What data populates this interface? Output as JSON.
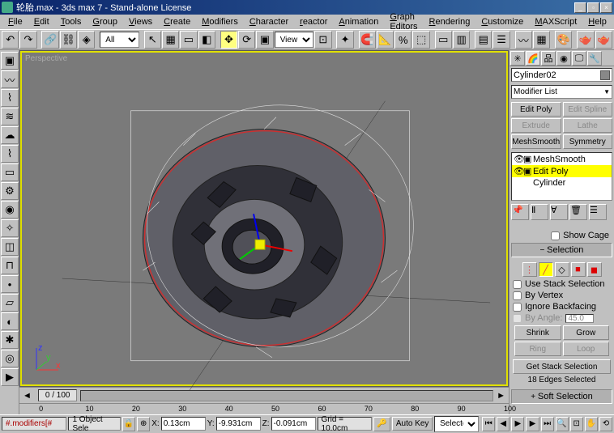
{
  "title": "轮胎.max - 3ds max 7 - Stand-alone License",
  "menus": [
    "File",
    "Edit",
    "Tools",
    "Group",
    "Views",
    "Create",
    "Modifiers",
    "Character",
    "reactor",
    "Animation",
    "Graph Editors",
    "Rendering",
    "Customize",
    "MAXScript",
    "Help"
  ],
  "toolbar": {
    "filter": "All",
    "view_dd": "View"
  },
  "viewport": {
    "label": "Perspective"
  },
  "timeline": {
    "frame": "0 / 100",
    "ticks": [
      "0",
      "10",
      "20",
      "30",
      "40",
      "50",
      "60",
      "70",
      "80",
      "90",
      "100"
    ]
  },
  "panel": {
    "objectName": "Cylinder02",
    "modifierList": "Modifier List",
    "buttons": {
      "editPoly": "Edit Poly",
      "editSpline": "Edit Spline",
      "extrude": "Extrude",
      "lathe": "Lathe",
      "meshSmooth": "MeshSmooth",
      "symmetry": "Symmetry"
    },
    "stack": [
      {
        "name": "MeshSmooth",
        "sel": false,
        "eye": true
      },
      {
        "name": "Edit Poly",
        "sel": true,
        "eye": true
      },
      {
        "name": "Cylinder",
        "sel": false,
        "eye": false
      }
    ],
    "showCage": "Show Cage",
    "selection": {
      "header": "Selection",
      "useStack": "Use Stack Selection",
      "byVertex": "By Vertex",
      "ignoreBack": "Ignore Backfacing",
      "byAngle": "By Angle:",
      "byAngleVal": "45.0",
      "shrink": "Shrink",
      "grow": "Grow",
      "ring": "Ring",
      "loop": "Loop",
      "getStack": "Get Stack Selection",
      "info": "18 Edges Selected"
    },
    "softSel": "Soft Selection"
  },
  "status": {
    "prompt": "#.modifiers[#",
    "objSel": "1 Object Sele",
    "x": "0.13cm",
    "y": "-9.931cm",
    "z": "-0.091cm",
    "grid": "Grid = 10.0cm",
    "autoKey": "Auto Key",
    "animMode": "Selected"
  }
}
